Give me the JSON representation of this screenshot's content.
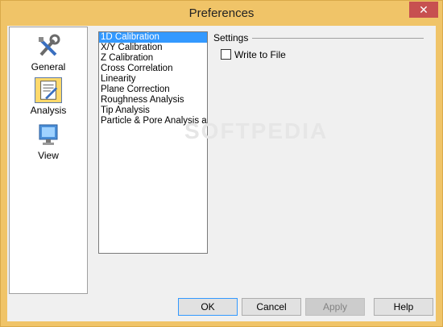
{
  "window": {
    "title": "Preferences",
    "close_glyph": "✕"
  },
  "sidebar": {
    "items": [
      {
        "label": "General",
        "icon": "tools-icon",
        "selected": false
      },
      {
        "label": "Analysis",
        "icon": "analysis-icon",
        "selected": true
      },
      {
        "label": "View",
        "icon": "monitor-icon",
        "selected": false
      }
    ]
  },
  "analysis_list": {
    "items": [
      "1D Calibration",
      "X/Y Calibration",
      "Z Calibration",
      "Cross Correlation",
      "Linearity",
      "Plane Correction",
      "Roughness Analysis",
      "Tip Analysis",
      "Particle & Pore Analysis and"
    ],
    "selected_index": 0
  },
  "settings": {
    "group_label": "Settings",
    "write_to_file_label": "Write to File",
    "write_to_file_checked": false
  },
  "watermark": "SOFTPEDIA",
  "footer": {
    "ok": "OK",
    "cancel": "Cancel",
    "apply": "Apply",
    "help": "Help"
  },
  "colors": {
    "titlebar": "#f0c468",
    "selection": "#3399ff",
    "close": "#c75050"
  }
}
